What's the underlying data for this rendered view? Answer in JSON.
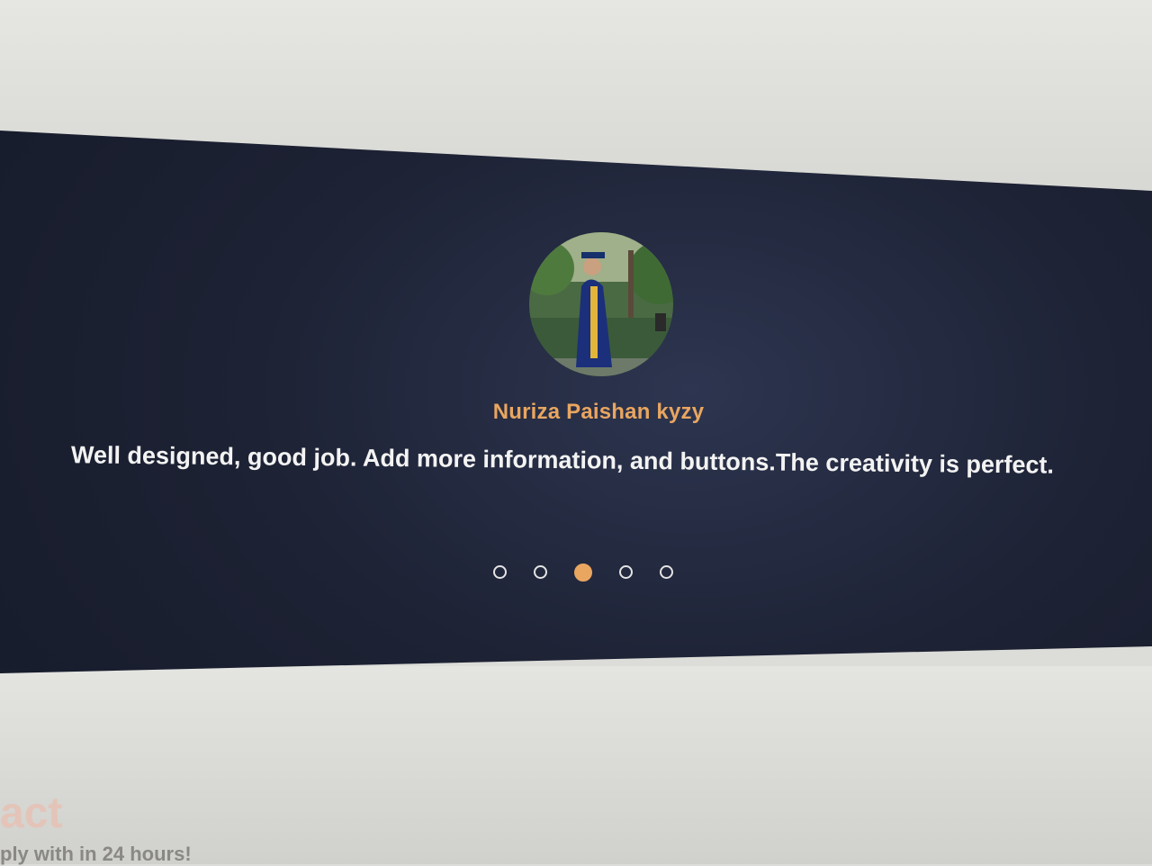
{
  "testimonial": {
    "author": "Nuriza Paishan kyzy",
    "quote": "Well designed, good job. Add more information, and buttons.The creativity is perfect.",
    "active_index": 2,
    "total_slides": 5,
    "accent_color": "#e9a660"
  },
  "contact": {
    "title": "act",
    "subtitle": "ply with in 24 hours!"
  }
}
